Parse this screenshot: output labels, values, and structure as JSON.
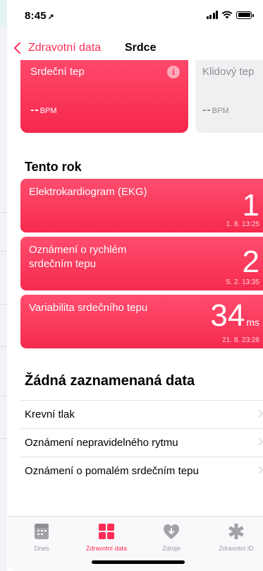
{
  "status": {
    "time": "8:45"
  },
  "nav": {
    "back_label": "Zdravotní data",
    "title": "Srdce"
  },
  "tiles": {
    "heart_rate": {
      "label": "Srdeční tep",
      "value": "--",
      "unit": "BPM",
      "info": "i"
    },
    "resting": {
      "label": "Klidový tep",
      "value": "--",
      "unit": "BPM"
    }
  },
  "this_year": {
    "title": "Tento rok",
    "items": [
      {
        "label": "Elektrokardiogram (EKG)",
        "value": "1",
        "unit": "",
        "timestamp": "1. 8. 13:25"
      },
      {
        "label": "Oznámení o rychlém srdečním tepu",
        "value": "2",
        "unit": "",
        "timestamp": "5. 2. 13:35"
      },
      {
        "label": "Variabilita srdečního tepu",
        "value": "34",
        "unit": "ms",
        "timestamp": "21. 8. 23:26"
      }
    ]
  },
  "no_data": {
    "title": "Žádná zaznamenaná data",
    "items": [
      {
        "label": "Krevní tlak"
      },
      {
        "label": "Oznámení nepravidelného rytmu"
      },
      {
        "label": "Oznámení o pomalém srdečním tepu"
      }
    ]
  },
  "tabbar": {
    "tabs": [
      {
        "label": "Dnes",
        "icon": "today-icon"
      },
      {
        "label": "Zdravotní data",
        "icon": "health-data-icon"
      },
      {
        "label": "Zdroje",
        "icon": "sources-icon"
      },
      {
        "label": "Zdravotní ID",
        "icon": "medical-id-icon"
      }
    ]
  },
  "colors": {
    "accent": "#ff2d55",
    "card_red": "#f6274c",
    "inactive": "#9a9aa0"
  }
}
